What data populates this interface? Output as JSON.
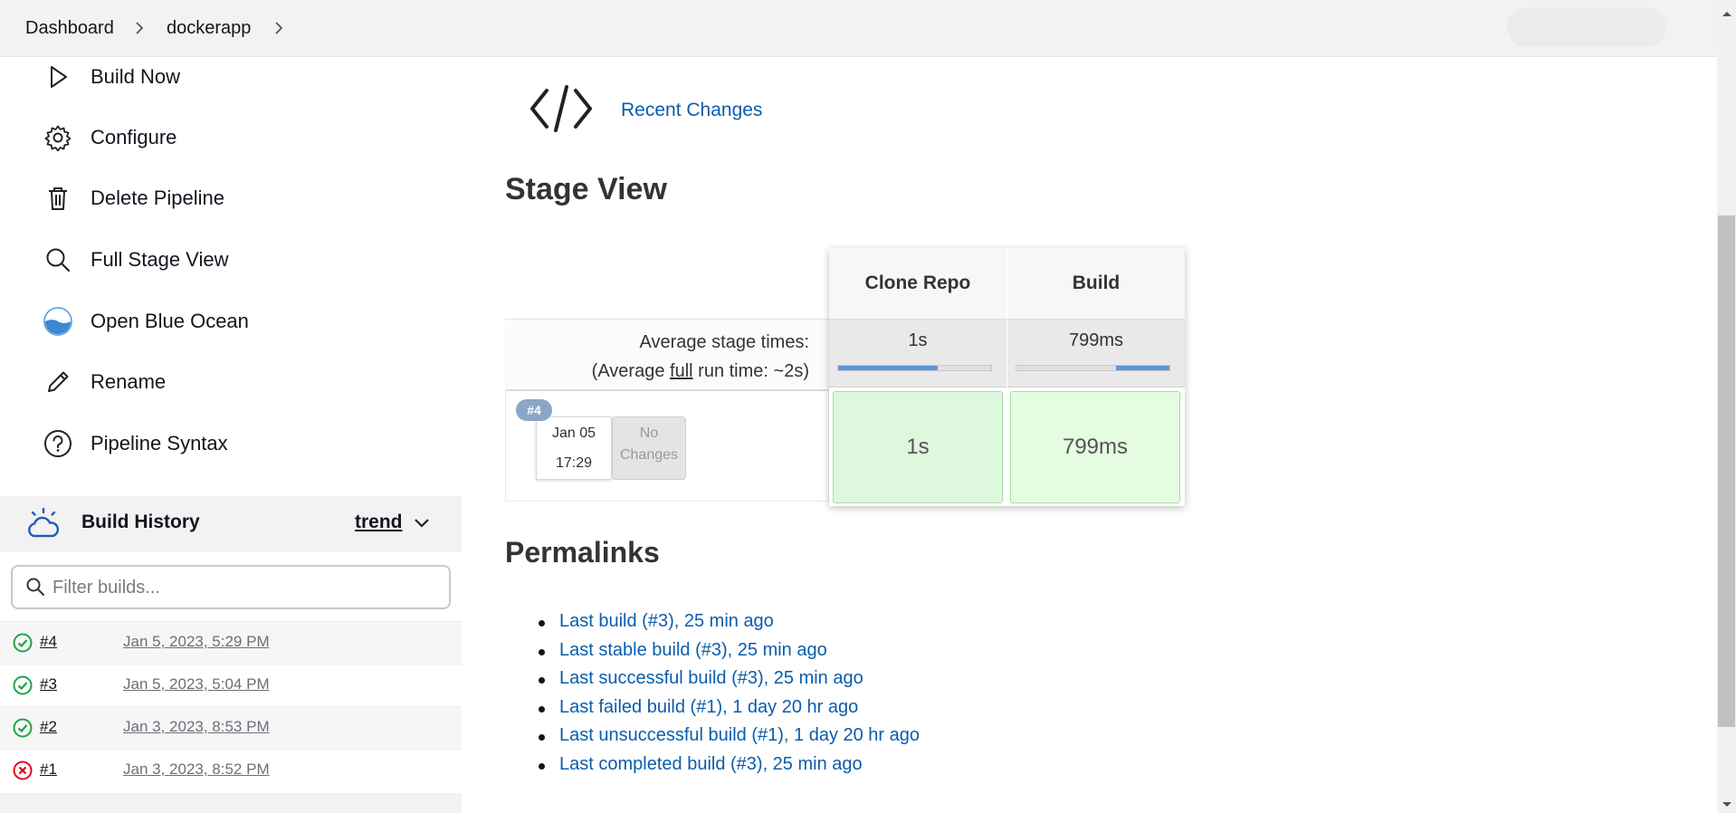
{
  "breadcrumb": {
    "items": [
      "Dashboard",
      "dockerapp"
    ]
  },
  "sidebar": {
    "items": [
      {
        "label": "Build Now",
        "icon": "play-icon"
      },
      {
        "label": "Configure",
        "icon": "gear-icon"
      },
      {
        "label": "Delete Pipeline",
        "icon": "trash-icon"
      },
      {
        "label": "Full Stage View",
        "icon": "search-icon"
      },
      {
        "label": "Open Blue Ocean",
        "icon": "blue-ocean-icon"
      },
      {
        "label": "Rename",
        "icon": "pencil-icon"
      },
      {
        "label": "Pipeline Syntax",
        "icon": "help-circle-icon"
      }
    ]
  },
  "build_history": {
    "title": "Build History",
    "trend": "trend",
    "filter_placeholder": "Filter builds...",
    "builds": [
      {
        "number": "#4",
        "date": "Jan 5, 2023, 5:29 PM",
        "status": "success"
      },
      {
        "number": "#3",
        "date": "Jan 5, 2023, 5:04 PM",
        "status": "success"
      },
      {
        "number": "#2",
        "date": "Jan 3, 2023, 8:53 PM",
        "status": "success"
      },
      {
        "number": "#1",
        "date": "Jan 3, 2023, 8:52 PM",
        "status": "failed"
      }
    ]
  },
  "main": {
    "recent_changes": "Recent Changes",
    "stage_view_title": "Stage View",
    "avg_stage_label": "Average stage times:",
    "avg_full_prefix": "(Average ",
    "avg_full_word": "full",
    "avg_full_suffix": " run time: ~2s)",
    "stages": [
      {
        "name": "Clone Repo",
        "avg": "1s",
        "avg_fraction": 0.65,
        "run_time": "1s"
      },
      {
        "name": "Build",
        "avg": "799ms",
        "avg_fraction": 0.35,
        "run_time": "799ms"
      }
    ],
    "run": {
      "badge": "#4",
      "date": "Jan 05",
      "time": "17:29",
      "changes_line1": "No",
      "changes_line2": "Changes"
    },
    "permalinks_title": "Permalinks",
    "permalinks": [
      "Last build (#3), 25 min ago",
      "Last stable build (#3), 25 min ago",
      "Last successful build (#3), 25 min ago",
      "Last failed build (#1), 1 day 20 hr ago",
      "Last unsuccessful build (#1), 1 day 20 hr ago",
      "Last completed build (#3), 25 min ago"
    ]
  },
  "colors": {
    "link": "#0b5cad",
    "success": "#1ea446",
    "failure": "#e6001f",
    "stage_success_bg": "#ddf8dd",
    "progress_fill": "#5f96d6"
  }
}
